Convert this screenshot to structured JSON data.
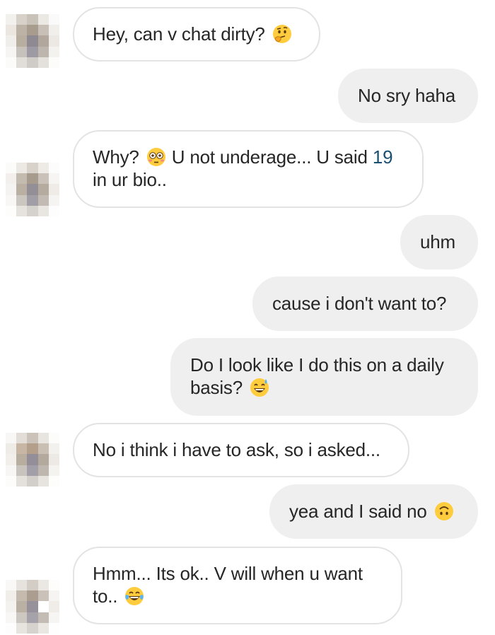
{
  "messages": [
    {
      "sender": "them",
      "text": "Hey, can v chat dirty?",
      "emoji": "thinking-face-emoji"
    },
    {
      "sender": "me",
      "text": "No sry haha"
    },
    {
      "sender": "them",
      "text_a": "Why?",
      "emoji": "flushed-face-emoji",
      "text_b": "U not underage... U said",
      "number": "19",
      "text_c": "in ur bio.."
    },
    {
      "sender": "me",
      "text": "uhm"
    },
    {
      "sender": "me",
      "text": "cause i don't want to?"
    },
    {
      "sender": "me",
      "text": "Do I look like I do this on a daily basis?",
      "emoji": "grinning-sweat-emoji"
    },
    {
      "sender": "them",
      "text": "No i think i have to ask, so i asked..."
    },
    {
      "sender": "me",
      "text": "yea and I said no",
      "emoji": "upside-down-face-emoji"
    },
    {
      "sender": "them",
      "text": "Hmm... Its ok.. V will when u want to..",
      "emoji": "tears-of-joy-emoji"
    }
  ],
  "colors": {
    "incoming_bubble_bg": "#ffffff",
    "incoming_bubble_border": "#e3e3e3",
    "outgoing_bubble_bg": "#efefef",
    "text": "#262626",
    "number_link": "#1b4f72"
  }
}
